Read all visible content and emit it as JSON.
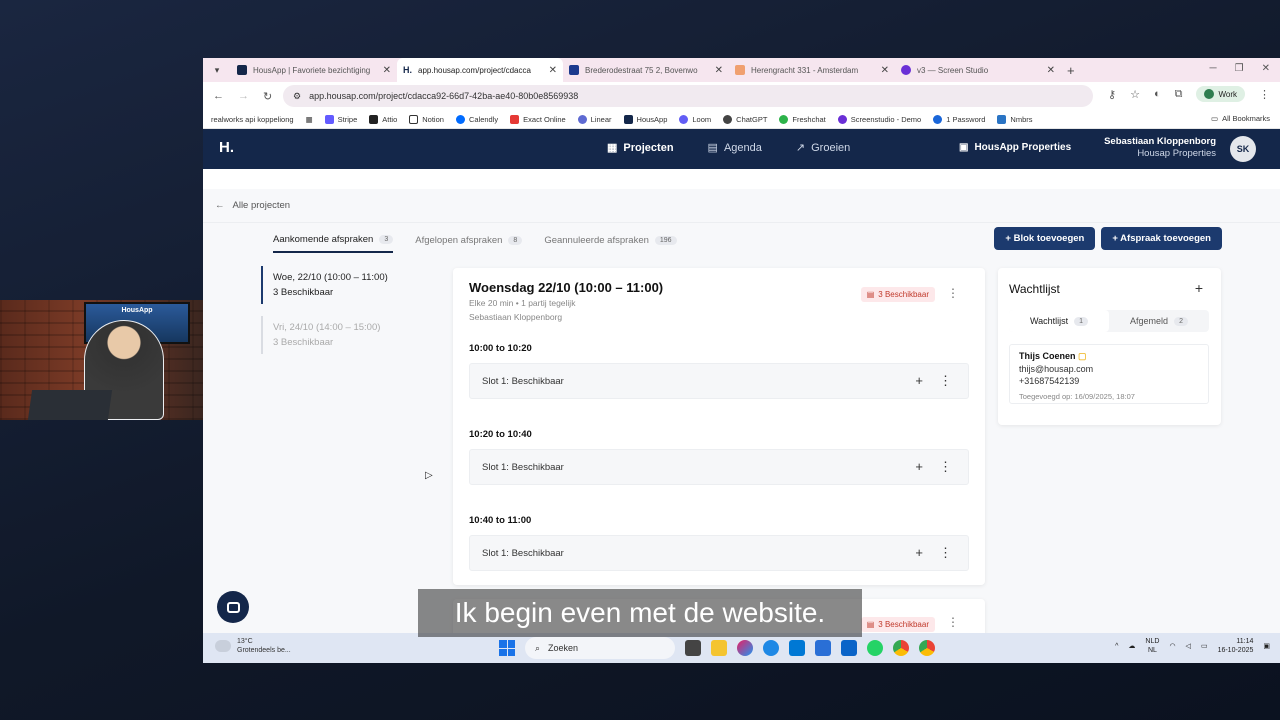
{
  "browser": {
    "tabs": [
      {
        "title": "HousApp | Favoriete bezichtiging",
        "color": "#14274a",
        "active": false
      },
      {
        "title": "app.housap.com/project/cdacca",
        "color": "#14274a",
        "active": true
      },
      {
        "title": "Brederodestraat 75 2, Bovenwo",
        "color": "#1c3a8e",
        "active": false
      },
      {
        "title": "Herengracht 331 - Amsterdam",
        "color": "#f0a070",
        "active": false
      },
      {
        "title": "v3 — Screen Studio",
        "color": "#6a2fd6",
        "active": false
      }
    ],
    "url": "app.housap.com/project/cdacca92-66d7-42ba-ae40-80b0e8569938",
    "profile": "Work",
    "bookmarks": [
      "realworks api koppeliong",
      "Stripe",
      "Attio",
      "Notion",
      "Calendly",
      "Exact Online",
      "Linear",
      "HousApp",
      "Loom",
      "ChatGPT",
      "Freshchat",
      "Screenstudio - Demo",
      "1 Password",
      "Nmbrs"
    ],
    "all_bookmarks": "All Bookmarks"
  },
  "nav": {
    "logo": "H.",
    "items": [
      "Projecten",
      "Agenda",
      "Groeien"
    ],
    "properties": "HousApp Properties",
    "user_name": "Sebastiaan Kloppenborg",
    "user_org": "Housap Properties",
    "initials": "SK"
  },
  "page": {
    "back": "Alle projecten",
    "tabs": [
      {
        "label": "Aankomende afspraken",
        "count": "3"
      },
      {
        "label": "Afgelopen afspraken",
        "count": "8"
      },
      {
        "label": "Geannuleerde afspraken",
        "count": "196"
      }
    ],
    "btn_block": "+ Blok toevoegen",
    "btn_appt": "+ Afspraak toevoegen",
    "dates": [
      {
        "label": "Woe, 22/10 (10:00 – 11:00)",
        "sub": "3 Beschikbaar"
      },
      {
        "label": "Vri, 24/10 (14:00 – 15:00)",
        "sub": "3 Beschikbaar"
      }
    ]
  },
  "card": {
    "title": "Woensdag 22/10 (10:00 – 11:00)",
    "meta1": "Elke 20 min • 1 partij tegelijk",
    "meta2": "Sebastiaan Kloppenborg",
    "badge": "3 Beschikbaar",
    "slots": [
      {
        "time": "10:00 to 10:20",
        "label": "Slot 1: Beschikbaar"
      },
      {
        "time": "10:20 to 10:40",
        "label": "Slot 1: Beschikbaar"
      },
      {
        "time": "10:40 to 11:00",
        "label": "Slot 1: Beschikbaar"
      }
    ]
  },
  "card2": {
    "badge": "3 Beschikbaar"
  },
  "waitlist": {
    "title": "Wachtlijst",
    "tabs": [
      {
        "label": "Wachtlijst",
        "count": "1"
      },
      {
        "label": "Afgemeld",
        "count": "2"
      }
    ],
    "person": {
      "name": "Thijs Coenen",
      "email": "thijs@housap.com",
      "phone": "+31687542139",
      "added": "Toegevoegd op: 16/09/2025, 18:07"
    }
  },
  "subtitle": "Ik begin even met de website.",
  "webcam_tv": "HousApp",
  "taskbar": {
    "temp": "13°C",
    "weather": "Grotendeels be...",
    "search": "Zoeken",
    "lang1": "NLD",
    "lang2": "NL",
    "time": "11:14",
    "date": "16-10-2025"
  }
}
